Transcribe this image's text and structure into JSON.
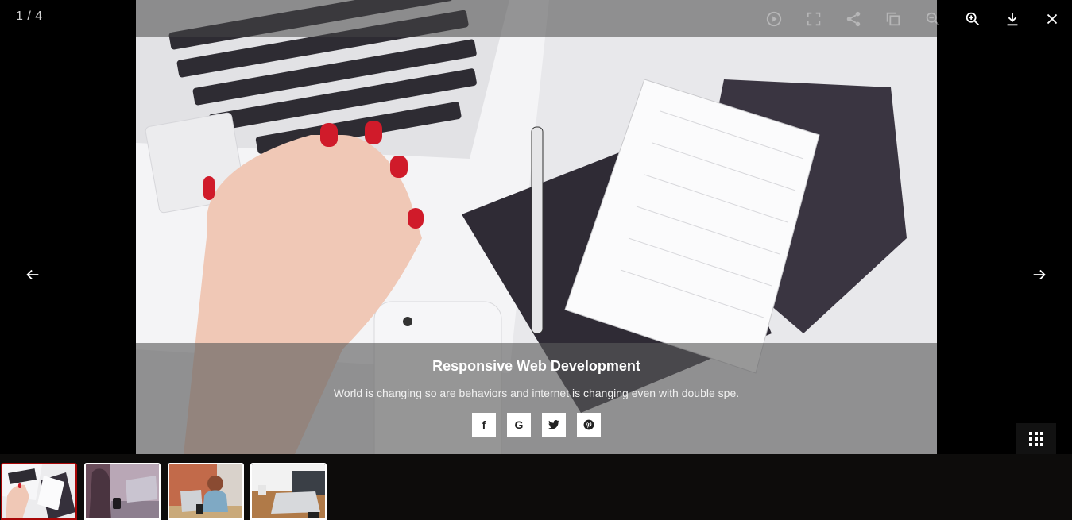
{
  "counter": "1 / 4",
  "toolbar": {
    "icons": [
      "play-icon",
      "fullscreen-icon",
      "share-icon",
      "copy-icon",
      "zoom-out-icon",
      "zoom-in-icon",
      "download-icon",
      "close-icon"
    ]
  },
  "caption": {
    "title": "Responsive Web Development",
    "subtitle": "World is changing so are behaviors and internet is changing even with double spe."
  },
  "socials": [
    "f",
    "G",
    "t",
    "p"
  ],
  "thumbnails": {
    "count": 4,
    "active_index": 0
  },
  "colors": {
    "background": "#000000",
    "thumb_active_border": "#a90707",
    "thumb_border": "#ffffff"
  }
}
